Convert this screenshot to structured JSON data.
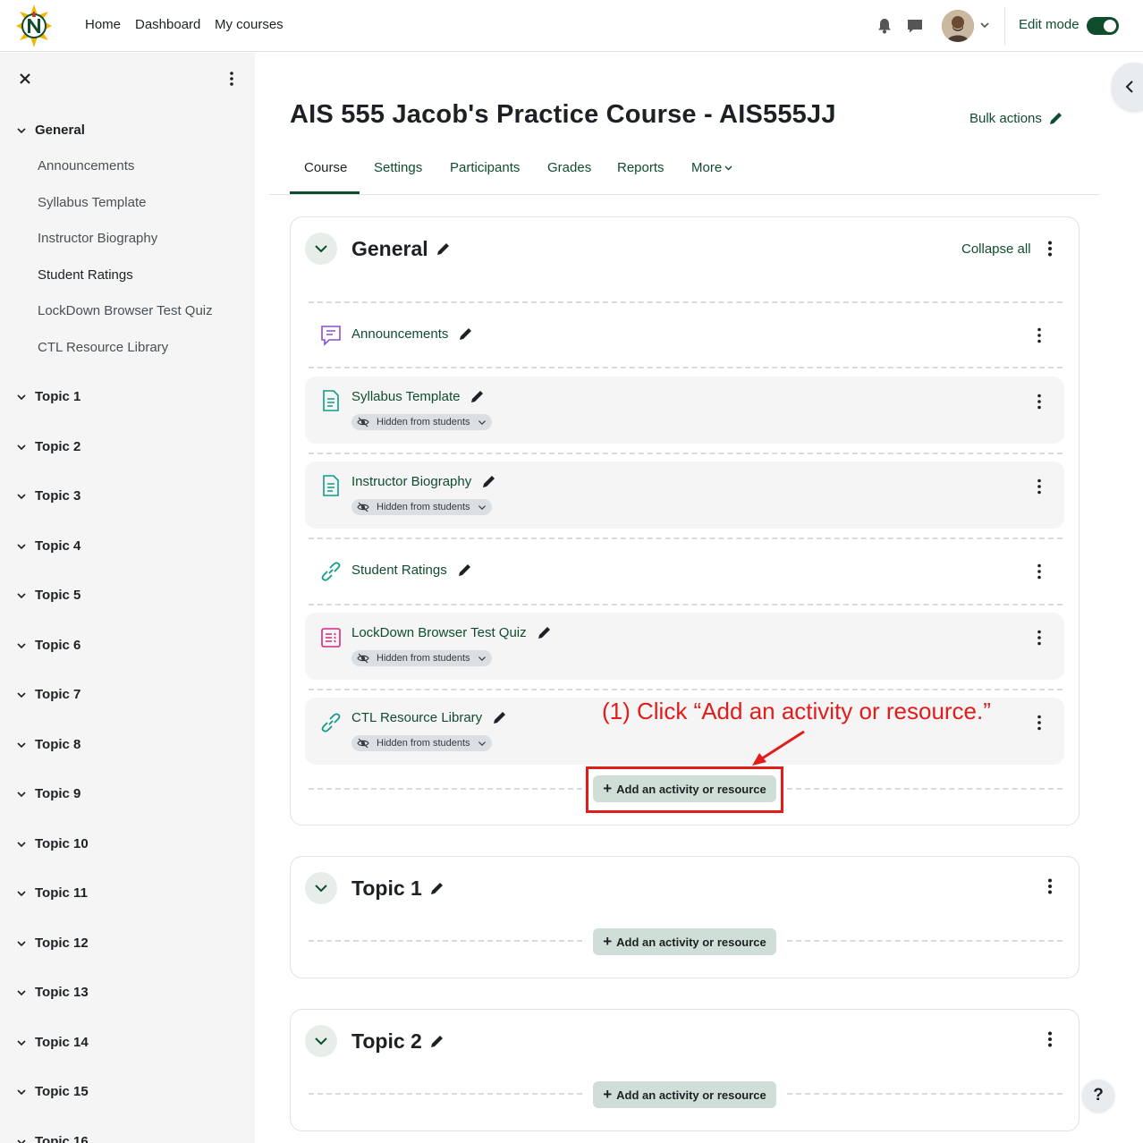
{
  "navbar": {
    "home": "Home",
    "dashboard": "Dashboard",
    "my_courses": "My courses",
    "edit_mode": "Edit mode",
    "edit_mode_on": true
  },
  "drawer": {
    "general": "General",
    "items": [
      "Announcements",
      "Syllabus Template",
      "Instructor Biography",
      "Student Ratings",
      "LockDown Browser Test Quiz",
      "CTL Resource Library"
    ],
    "topics": [
      "Topic 1",
      "Topic 2",
      "Topic 3",
      "Topic 4",
      "Topic 5",
      "Topic 6",
      "Topic 7",
      "Topic 8",
      "Topic 9",
      "Topic 10",
      "Topic 11",
      "Topic 12",
      "Topic 13",
      "Topic 14",
      "Topic 15",
      "Topic 16"
    ]
  },
  "header": {
    "title": "AIS 555 Jacob's Practice Course - AIS555JJ",
    "bulk_actions": "Bulk actions"
  },
  "tabs": {
    "course": "Course",
    "settings": "Settings",
    "participants": "Participants",
    "grades": "Grades",
    "reports": "Reports",
    "more": "More"
  },
  "general_section": {
    "title": "General",
    "collapse_all": "Collapse all",
    "activities": [
      {
        "name": "Announcements",
        "type": "forum",
        "hidden": false
      },
      {
        "name": "Syllabus Template",
        "type": "page",
        "hidden": true
      },
      {
        "name": "Instructor Biography",
        "type": "page",
        "hidden": true
      },
      {
        "name": "Student Ratings",
        "type": "url",
        "hidden": false
      },
      {
        "name": "LockDown Browser Test Quiz",
        "type": "quiz",
        "hidden": true
      },
      {
        "name": "CTL Resource Library",
        "type": "url",
        "hidden": true
      }
    ],
    "hidden_badge": "Hidden from students",
    "add_label": "Add an activity or resource"
  },
  "topic1": {
    "title": "Topic 1",
    "add_label": "Add an activity or resource"
  },
  "topic2": {
    "title": "Topic 2",
    "add_label": "Add an activity or resource"
  },
  "annotation": {
    "text": "(1) Click “Add an activity or resource.”",
    "color": "#e21b1b"
  },
  "help": "?",
  "colors": {
    "brand": "#0f4d2d",
    "drawer_bg": "#f5f5f5"
  }
}
